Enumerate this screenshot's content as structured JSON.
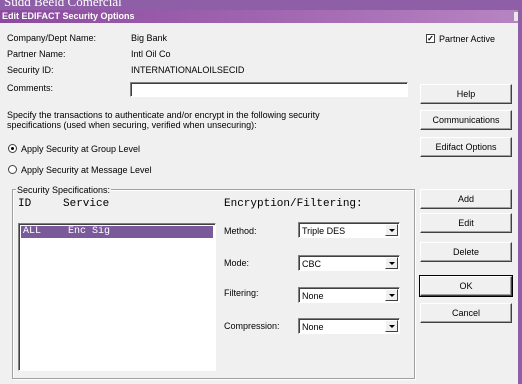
{
  "background_text": "Sudd Beeld Comercial",
  "window": {
    "title": "Edit EDIFACT Security Options"
  },
  "info": {
    "company_label": "Company/Dept Name:",
    "company_value": "Big Bank",
    "partner_label": "Partner Name:",
    "partner_value": "Intl Oil Co",
    "security_id_label": "Security ID:",
    "security_id_value": "INTERNATIONALOILSECID",
    "comments_label": "Comments:",
    "comments_value": ""
  },
  "partner_active": {
    "label": "Partner Active",
    "checked": true
  },
  "instructions": {
    "line1": "Specify the transactions to authenticate and/or encrypt in the following security",
    "line2": "specifications (used when securing, verified when unsecuring):"
  },
  "security_level": {
    "group_label": "Apply Security at Group Level",
    "message_label": "Apply Security at Message Level",
    "selected": "group"
  },
  "specs": {
    "legend": "Security Specifications:",
    "col_id": "ID",
    "col_service": "Service",
    "col_encryption": "Encryption/Filtering:",
    "rows": [
      {
        "id": "ALL",
        "service": "Enc Sig",
        "selected": true
      }
    ],
    "method_label": "Method:",
    "method_value": "Triple DES",
    "mode_label": "Mode:",
    "mode_value": "CBC",
    "filtering_label": "Filtering:",
    "filtering_value": "None",
    "compression_label": "Compression:",
    "compression_value": "None"
  },
  "buttons": {
    "help": "Help",
    "communications": "Communications",
    "edifact_options": "Edifact Options",
    "add": "Add",
    "edit": "Edit",
    "delete": "Delete",
    "ok": "OK",
    "cancel": "Cancel"
  },
  "colors": {
    "titlebar": "#8b4a9e",
    "selection": "#7b5a9c",
    "dialog_bg": "#f0f0f0",
    "desktop": "#8e5fa6"
  }
}
